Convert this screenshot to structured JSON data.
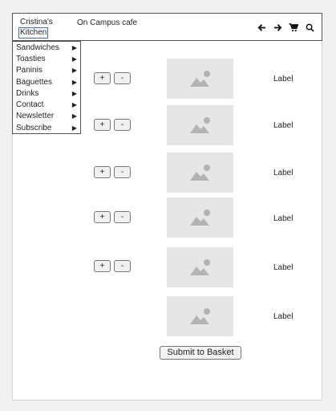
{
  "header": {
    "logo_line1": "Cristina's",
    "logo_line2": "Kitchen",
    "cafe_name": "On Campus cafe",
    "icons": [
      "arrow-left-icon",
      "arrow-right-icon",
      "cart-icon",
      "search-icon"
    ]
  },
  "menu": {
    "items": [
      {
        "label": "Sandwiches"
      },
      {
        "label": "Toasties"
      },
      {
        "label": "Paninis"
      },
      {
        "label": "Baguettes"
      },
      {
        "label": "Drinks"
      },
      {
        "label": "Contact"
      },
      {
        "label": "Newsletter"
      },
      {
        "label": "Subscribe"
      }
    ],
    "arrow_glyph": "▶"
  },
  "products": [
    {
      "plus": "+",
      "minus": "-",
      "label": "Label"
    },
    {
      "plus": "+",
      "minus": "-",
      "label": "Label"
    },
    {
      "plus": "+",
      "minus": "-",
      "label": "Label"
    },
    {
      "plus": "+",
      "minus": "-",
      "label": "Label"
    },
    {
      "plus": "+",
      "minus": "-",
      "label": "Label"
    },
    {
      "label": "Label"
    }
  ],
  "submit_label": "Submit to Basket"
}
